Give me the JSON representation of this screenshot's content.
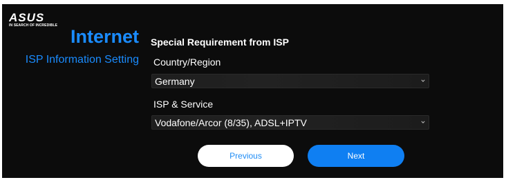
{
  "brand": {
    "logo_text": "ASUS",
    "tagline": "IN SEARCH OF INCREDIBLE"
  },
  "header": {
    "title": "Internet",
    "subtitle": "ISP Information Setting"
  },
  "form": {
    "heading": "Special Requirement from ISP",
    "country_label": "Country/Region",
    "country_value": "Germany",
    "isp_label": "ISP & Service",
    "isp_value": "Vodafone/Arcor (8/35), ADSL+IPTV"
  },
  "buttons": {
    "previous_label": "Previous",
    "next_label": "Next"
  },
  "colors": {
    "accent": "#1a8cff",
    "background": "#0c0c0c",
    "next_button": "#0f7ff2",
    "previous_button": "#ffffff"
  },
  "icons": {
    "logo": "asus-logo",
    "dropdown": "chevron-down-icon"
  }
}
